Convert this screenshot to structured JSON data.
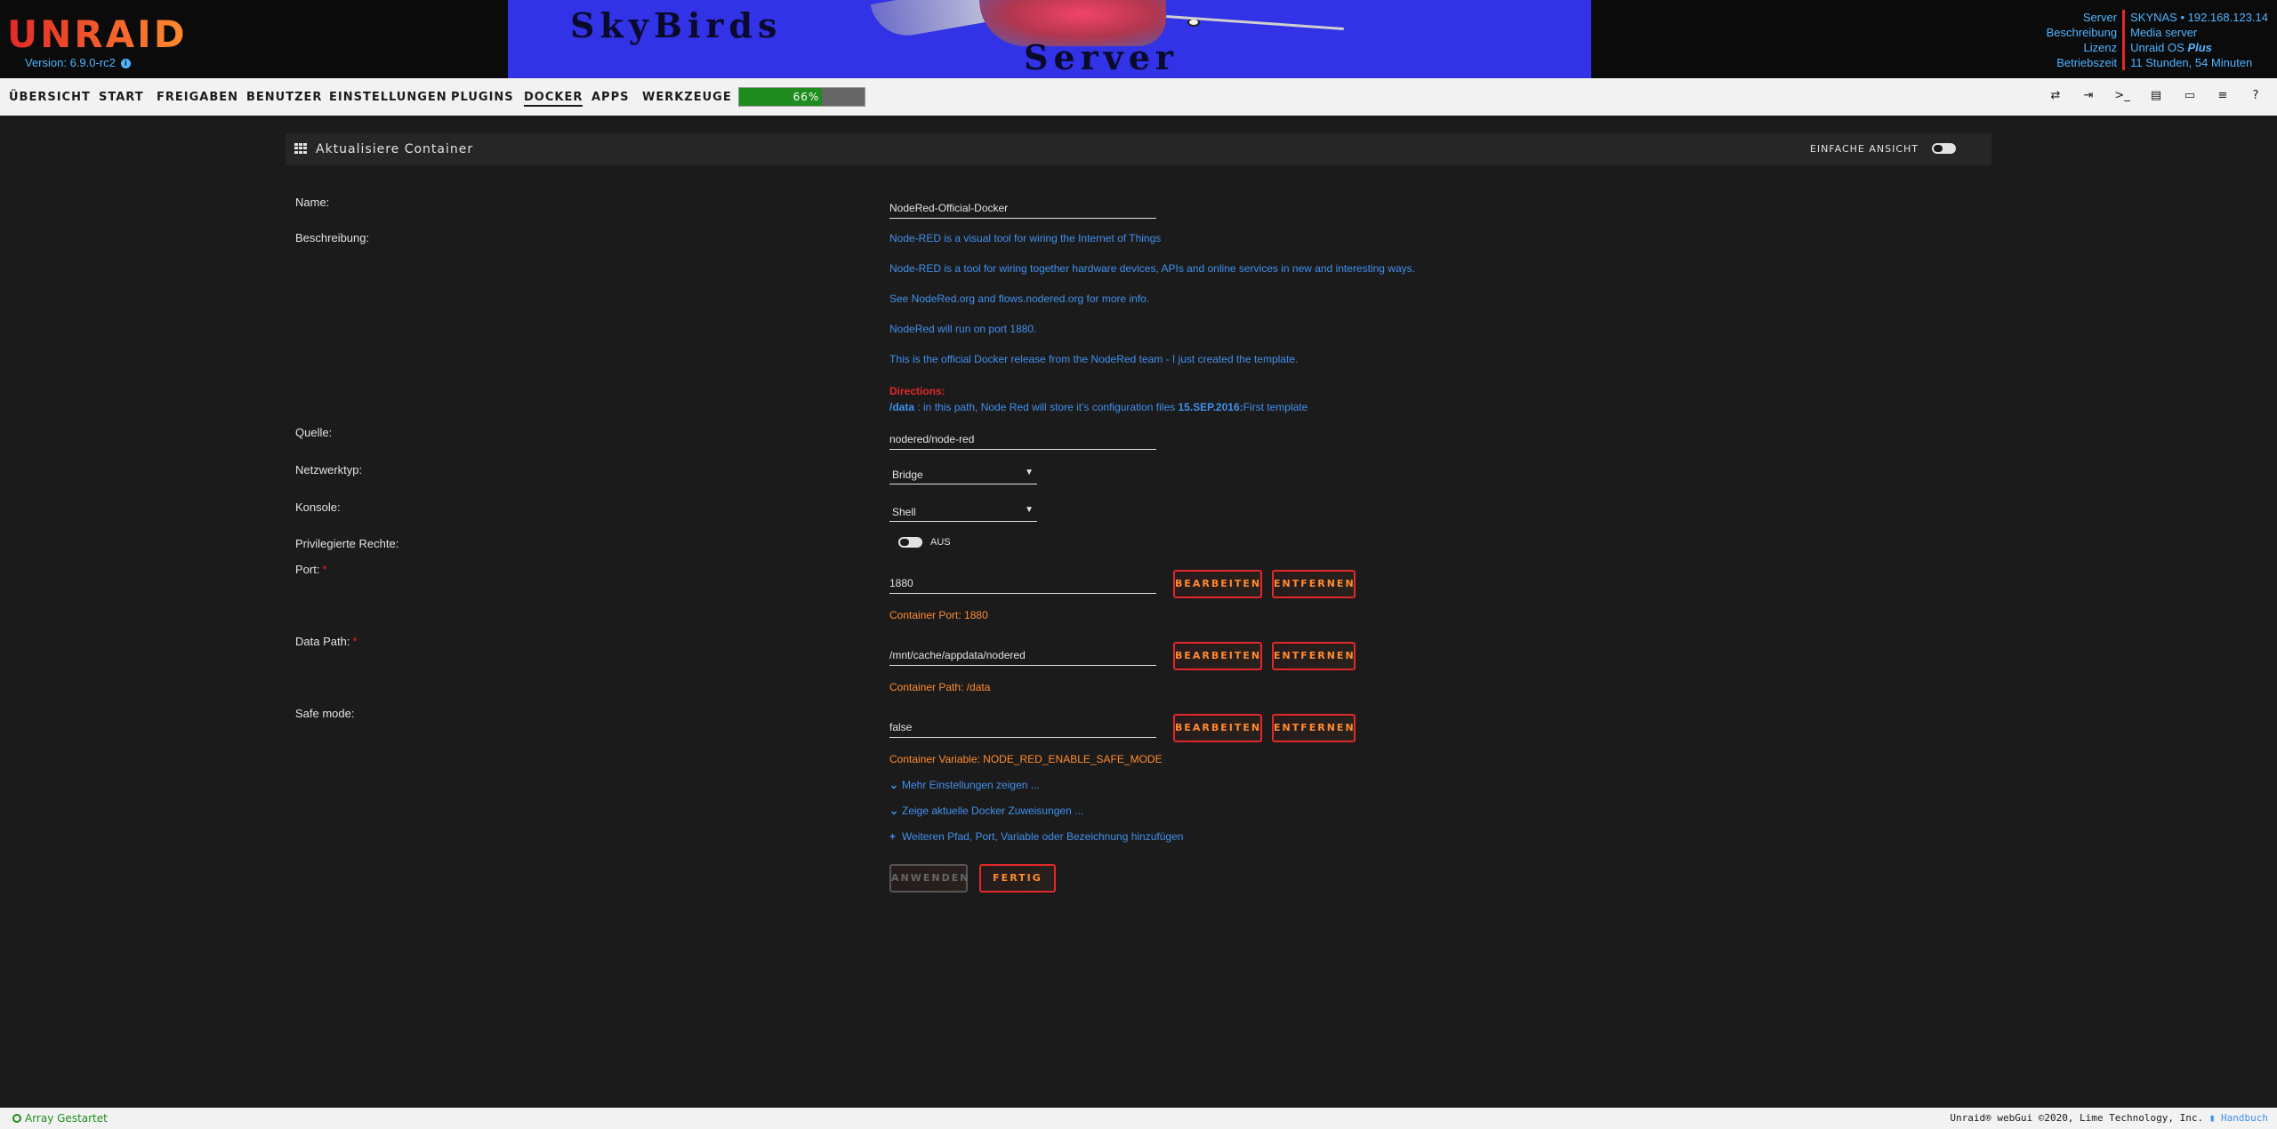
{
  "header": {
    "logo": "UNRAID",
    "version": "Version: 6.9.0-rc2",
    "banner": {
      "line1": "SkyBirds",
      "line2": "Server"
    },
    "server_info": {
      "labels": [
        "Server",
        "Beschreibung",
        "Lizenz",
        "Betriebszeit"
      ],
      "server_value": "SKYNAS • 192.168.123.14",
      "description_value": "Media server",
      "license_value": "Unraid OS",
      "license_plus": "Plus",
      "uptime_value": "11 Stunden, 54 Minuten"
    }
  },
  "nav": {
    "items": [
      "ÜBERSICHT",
      "START",
      "FREIGABEN",
      "BENUTZER",
      "EINSTELLUNGEN",
      "PLUGINS",
      "DOCKER",
      "APPS",
      "WERKZEUGE"
    ],
    "active": "DOCKER",
    "cpu_load_text": "66%",
    "cpu_load": 0.66,
    "tool_icons": [
      "transfer-icon",
      "logout-icon",
      "terminal-icon",
      "feedback-icon",
      "monitor-icon",
      "log-icon",
      "help-icon"
    ]
  },
  "panel": {
    "title": "Aktualisiere Container",
    "simple_view": "EINFACHE ANSICHT"
  },
  "form": {
    "name_label": "Name:",
    "name_value": "NodeRed-Official-Docker",
    "description_label": "Beschreibung:",
    "description_lines": [
      "Node-RED is a visual tool for wiring the Internet of Things",
      "Node-RED is a tool for wiring together hardware devices, APIs and online services in new and interesting ways.",
      "See NodeRed.org and flows.nodered.org for more info.",
      "NodeRed will run on port 1880.",
      "This is the official Docker release from the NodeRed team - I just created the template."
    ],
    "directions_title": "Directions:",
    "directions_path": "/data",
    "directions_text": " : in this path, Node Red will store it's configuration files ",
    "directions_date": "15.SEP.2016:",
    "directions_tail": "First template",
    "source_label": "Quelle:",
    "source_value": "nodered/node-red",
    "network_label": "Netzwerktyp:",
    "network_value": "Bridge",
    "console_label": "Konsole:",
    "console_value": "Shell",
    "privileged_label": "Privilegierte Rechte:",
    "privileged_value": "AUS",
    "port_label": "Port:",
    "port_value": "1880",
    "port_note": "Container Port: 1880",
    "datapath_label": "Data Path:",
    "datapath_value": "/mnt/cache/appdata/nodered",
    "datapath_note": "Container Path: /data",
    "safemode_label": "Safe mode:",
    "safemode_value": "false",
    "safemode_note": "Container Variable: NODE_RED_ENABLE_SAFE_MODE",
    "edit_label": "BEARBEITEN",
    "remove_label": "ENTFERNEN",
    "more_settings": "Mehr Einstellungen zeigen ...",
    "show_allocations": "Zeige aktuelle Docker Zuweisungen ...",
    "add_more": "Weiteren Pfad, Port, Variable oder Bezeichnung hinzufügen",
    "apply_label": "ANWENDEN",
    "done_label": "FERTIG"
  },
  "footer": {
    "status": "Array Gestartet",
    "copyright": "Unraid® webGui ©2020, Lime Technology, Inc.",
    "manual": "Handbuch"
  },
  "colors": {
    "accent": "#ff8c2f",
    "link": "#3f90ee",
    "danger": "#e22828",
    "ok": "#1e8c1e"
  }
}
